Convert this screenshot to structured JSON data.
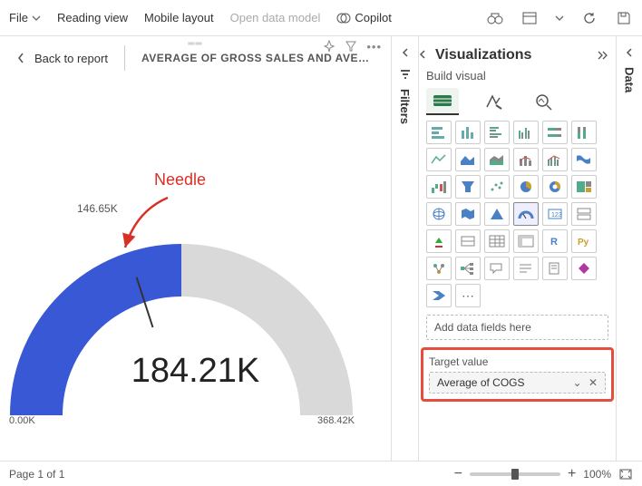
{
  "topbar": {
    "file": "File",
    "reading_view": "Reading view",
    "mobile_layout": "Mobile layout",
    "open_data_model": "Open data model",
    "copilot": "Copilot"
  },
  "header": {
    "back": "Back to report",
    "title": "AVERAGE OF GROSS SALES AND AVERAG…"
  },
  "annotation": {
    "needle": "Needle"
  },
  "chart_data": {
    "type": "gauge",
    "value": 184.21,
    "value_label": "184.21K",
    "min": 0.0,
    "min_label": "0.00K",
    "max": 368.42,
    "max_label": "368.42K",
    "target": 146.65,
    "target_label": "146.65K",
    "measure": "Average of Gross Sales",
    "target_measure": "Average of COGS",
    "unit": "K"
  },
  "panes": {
    "filters": "Filters",
    "visualizations": "Visualizations",
    "build_visual": "Build visual",
    "values_well_placeholder": "Add data fields here",
    "target_label": "Target value",
    "target_field": "Average of COGS",
    "data": "Data"
  },
  "status": {
    "page": "Page 1 of 1",
    "zoom": "100%"
  }
}
